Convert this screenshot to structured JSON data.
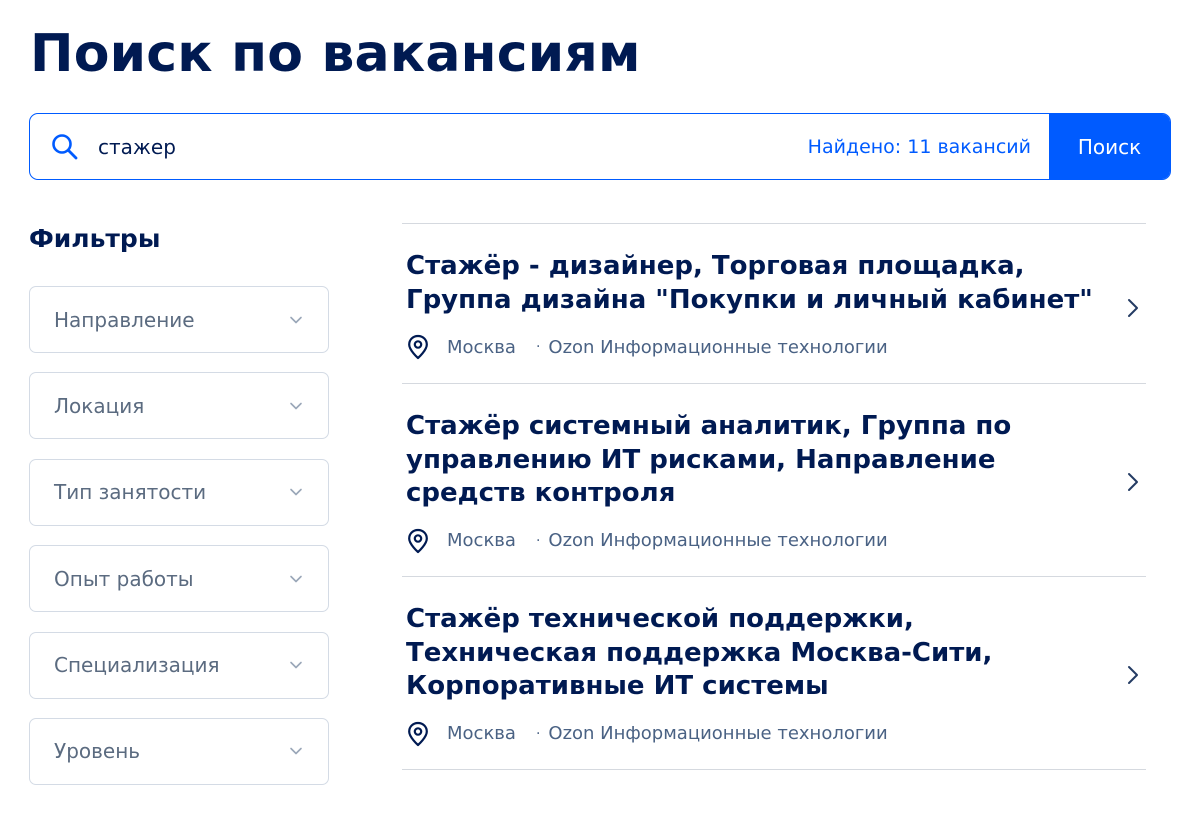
{
  "page": {
    "title": "Поиск по вакансиям"
  },
  "search": {
    "value": "стажер",
    "found": "Найдено: 11 вакансий",
    "button": "Поиск"
  },
  "filters": {
    "title": "Фильтры",
    "items": [
      {
        "label": "Направление"
      },
      {
        "label": "Локация"
      },
      {
        "label": "Тип занятости"
      },
      {
        "label": "Опыт работы"
      },
      {
        "label": "Специализация"
      },
      {
        "label": "Уровень"
      }
    ]
  },
  "vacancies": [
    {
      "title": "Стажёр - дизайнер, Торговая площадка, Группа дизайна \"Покупки и личный кабинет\"",
      "city": "Москва",
      "company": "Ozon Информационные технологии"
    },
    {
      "title": "Стажёр системный аналитик, Группа по управлению ИТ рисками, Направление средств контроля",
      "city": "Москва",
      "company": "Ozon Информационные технологии"
    },
    {
      "title": "Стажёр технической поддержки, Техническая поддержка Москва-Сити, Корпоративные ИТ системы",
      "city": "Москва",
      "company": "Ozon Информационные технологии"
    }
  ],
  "icons": {
    "search": "search-icon",
    "dropdown": "chevron-down-icon",
    "location": "map-pin-icon",
    "open": "chevron-right-icon"
  },
  "colors": {
    "accent": "#005bff",
    "heading": "#001a52",
    "muted": "#5b6b80",
    "border": "#d4dbe5"
  }
}
